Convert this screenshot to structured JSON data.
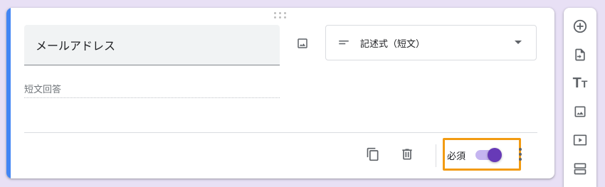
{
  "question": {
    "title": "メールアドレス",
    "answer_hint": "短文回答",
    "type_label": "記述式（短文）"
  },
  "footer": {
    "required_label": "必須",
    "required_on": true
  },
  "icons": {
    "drag": "drag-handle-icon",
    "image": "image-icon",
    "type": "short-text-icon",
    "dropdown": "dropdown-arrow-icon",
    "copy": "copy-icon",
    "delete": "trash-icon",
    "more": "more-vert-icon",
    "toolbar": [
      "add-question-icon",
      "import-questions-icon",
      "title-text-icon",
      "add-image-icon",
      "add-video-icon",
      "add-section-icon"
    ]
  },
  "colors": {
    "accent": "#4285f4",
    "toggle_thumb": "#673ab7",
    "toggle_track": "#c5b5f0",
    "highlight": "#f29b12",
    "background": "#e8e0f5"
  }
}
